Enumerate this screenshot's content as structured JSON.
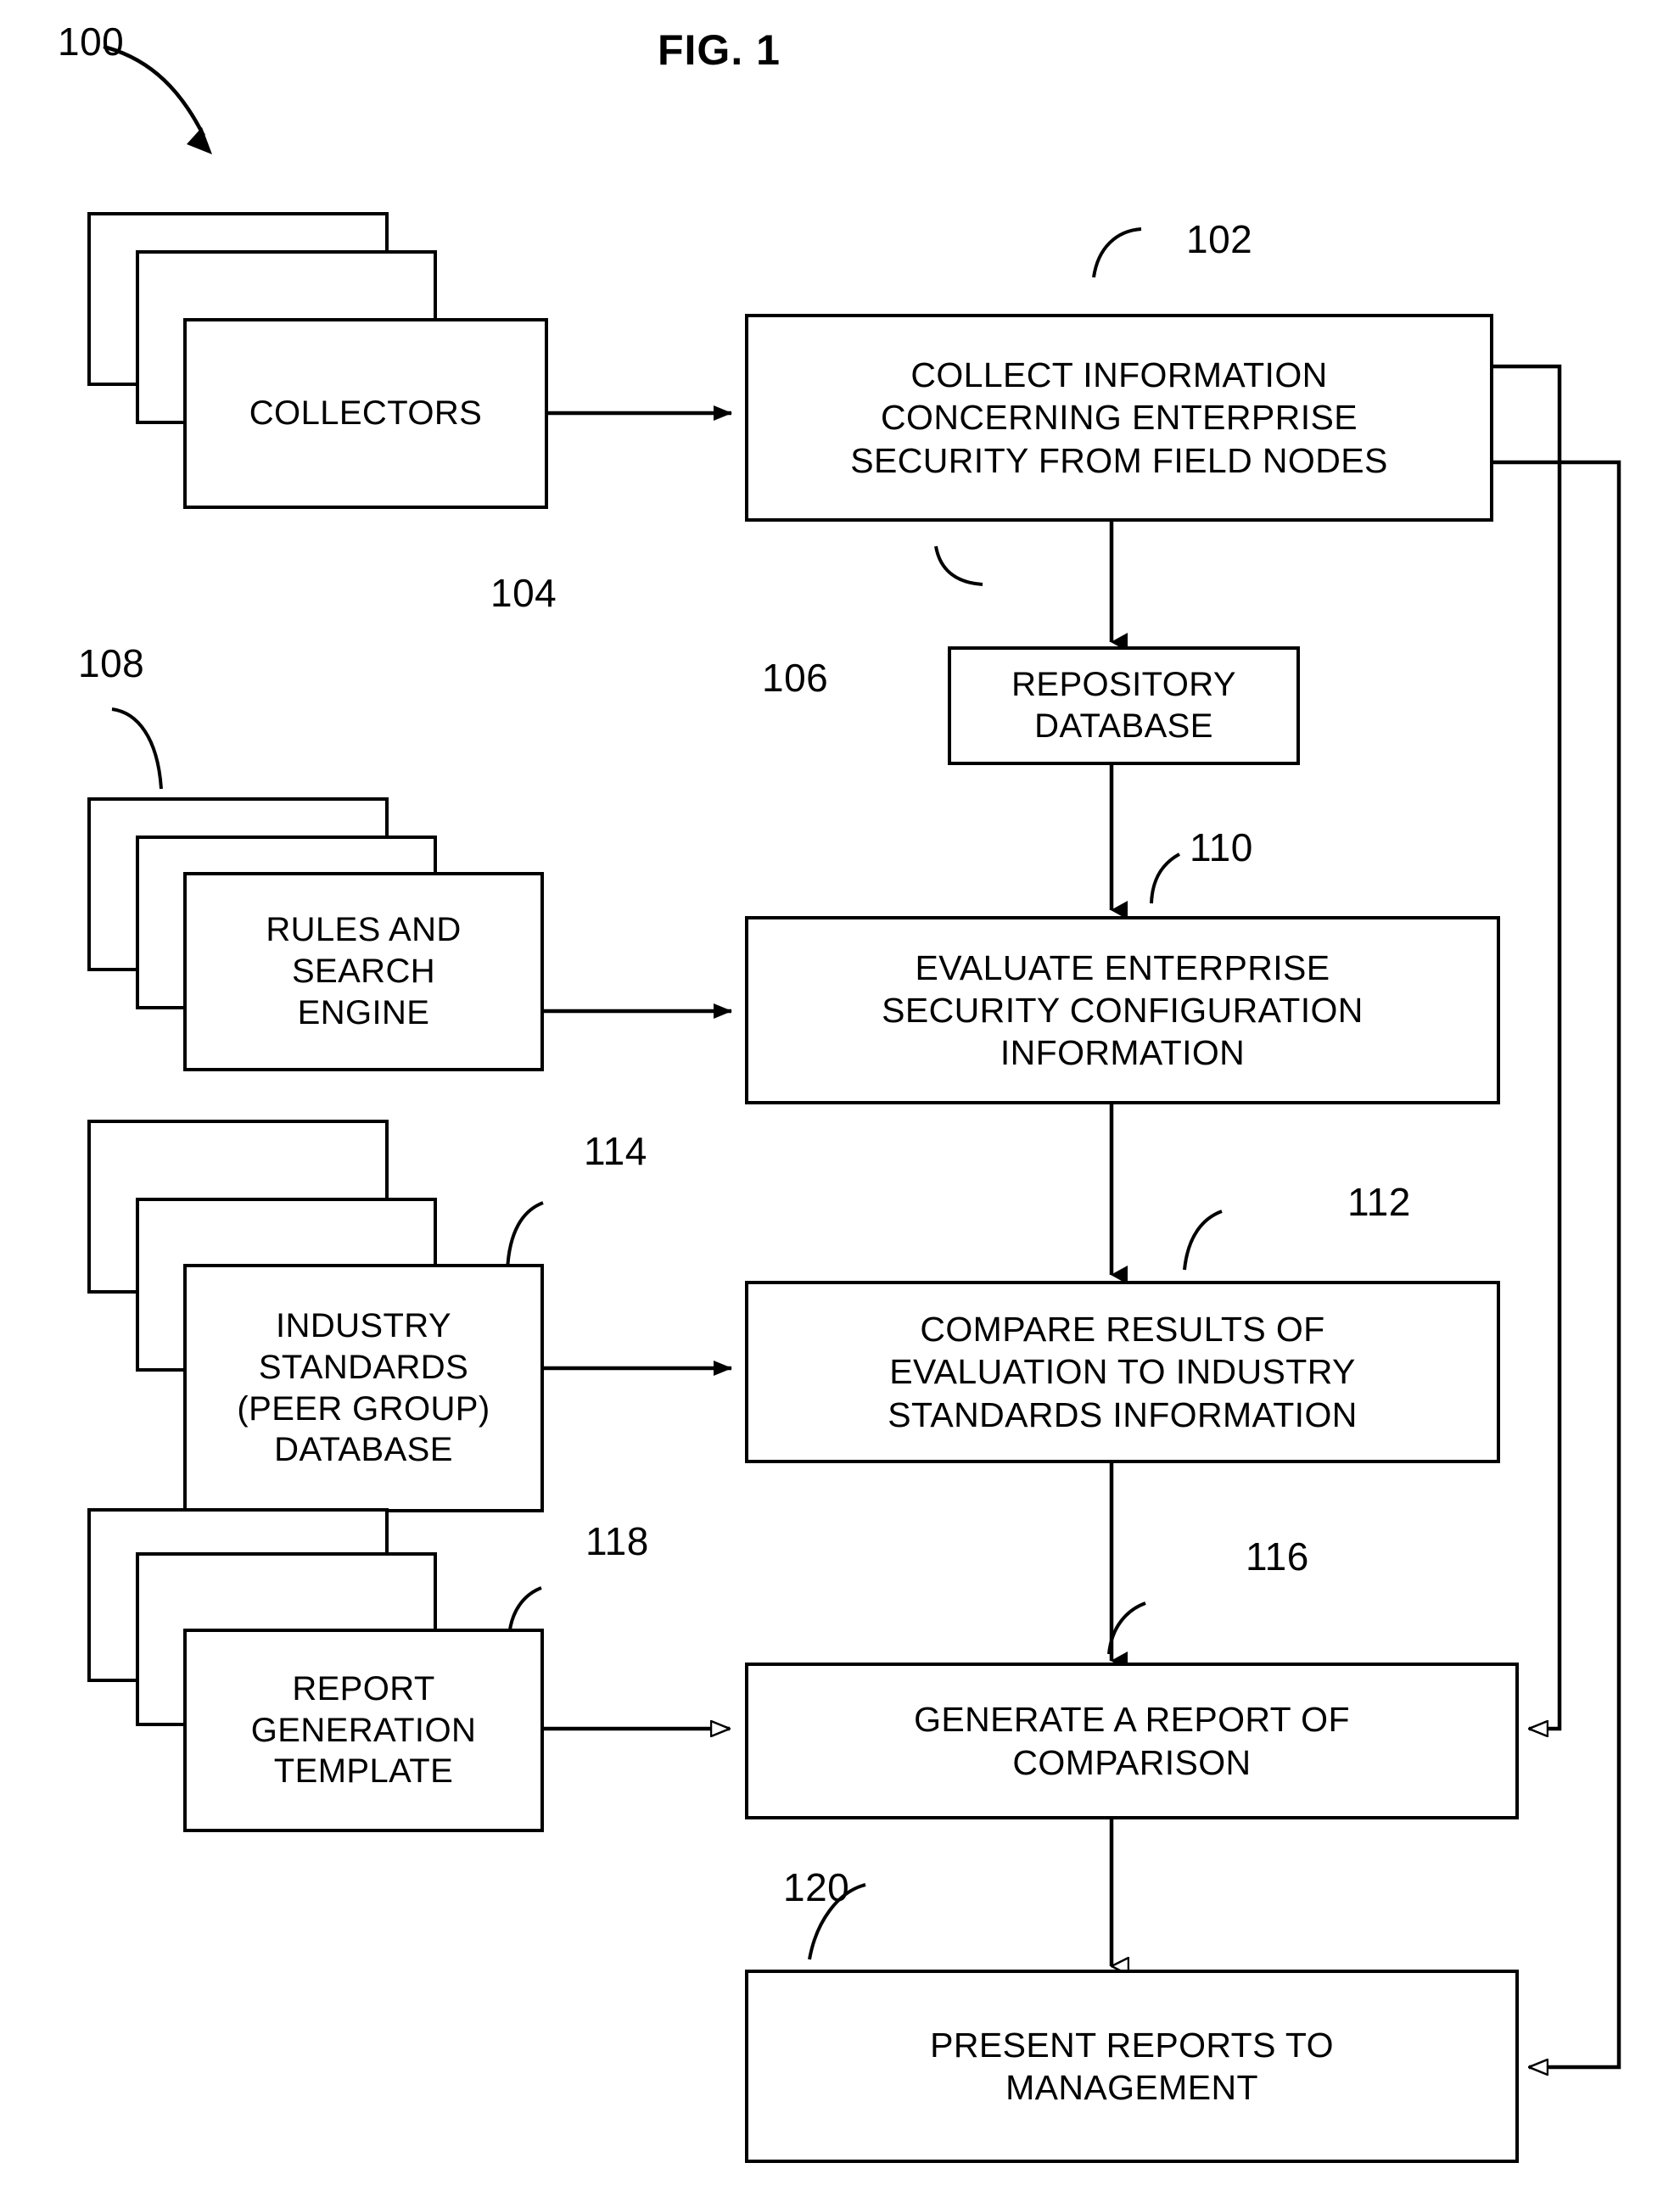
{
  "figure": {
    "title": "FIG. 1",
    "system_ref": "100"
  },
  "refs": {
    "system": "100",
    "collect_step": "102",
    "collectors": "104",
    "repository": "106",
    "rules_engine": "108",
    "evaluate_step": "110",
    "compare_step": "112",
    "industry_standards": "114",
    "generate_step": "116",
    "report_template": "118",
    "present_step": "120"
  },
  "nodes": {
    "collectors": {
      "label": "COLLECTORS",
      "ref": "104",
      "type": "stack"
    },
    "collect_step": {
      "label": "COLLECT INFORMATION\nCONCERNING ENTERPRISE\nSECURITY FROM FIELD NODES",
      "ref": "102",
      "type": "process"
    },
    "repository": {
      "label": "REPOSITORY\nDATABASE",
      "ref": "106",
      "type": "datastore"
    },
    "rules_engine": {
      "label": "RULES AND\nSEARCH\nENGINE",
      "ref": "108",
      "type": "stack"
    },
    "evaluate_step": {
      "label": "EVALUATE ENTERPRISE\nSECURITY CONFIGURATION\nINFORMATION",
      "ref": "110",
      "type": "process"
    },
    "industry_standards": {
      "label": "INDUSTRY\nSTANDARDS\n(PEER GROUP)\nDATABASE",
      "ref": "114",
      "type": "stack"
    },
    "compare_step": {
      "label": "COMPARE RESULTS OF\nEVALUATION TO INDUSTRY\nSTANDARDS INFORMATION",
      "ref": "112",
      "type": "process"
    },
    "report_template": {
      "label": "REPORT\nGENERATION\nTEMPLATE",
      "ref": "118",
      "type": "stack"
    },
    "generate_step": {
      "label": "GENERATE A REPORT OF\nCOMPARISON",
      "ref": "116",
      "type": "process"
    },
    "present_step": {
      "label": "PRESENT REPORTS TO\nMANAGEMENT",
      "ref": "120",
      "type": "process"
    }
  },
  "colors": {
    "ink": "#000000",
    "paper": "#ffffff"
  }
}
